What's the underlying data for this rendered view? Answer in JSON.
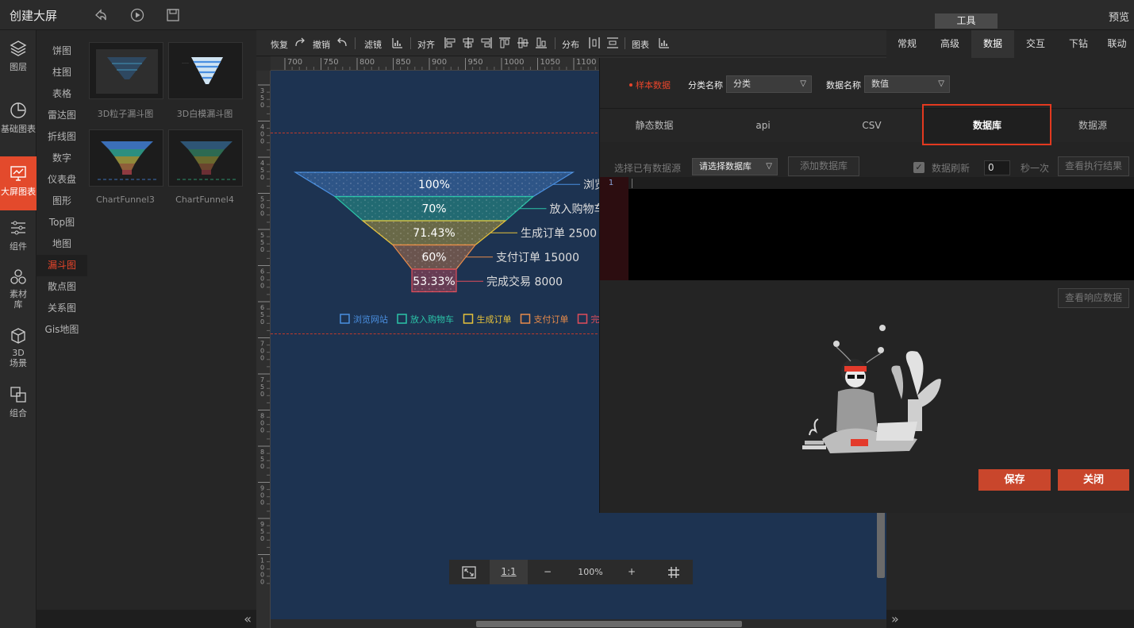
{
  "header": {
    "title": "创建大屏",
    "preview": "预览",
    "tools_tab": "工具"
  },
  "rail": [
    {
      "label": "图层",
      "icon": "layers-icon"
    },
    {
      "label": "基础图表",
      "icon": "pie-chart-icon"
    },
    {
      "label": "大屏图表",
      "icon": "monitor-chart-icon"
    },
    {
      "label": "组件",
      "icon": "sliders-icon"
    },
    {
      "label": "素材库",
      "icon": "materials-icon"
    },
    {
      "label": "3D场景",
      "icon": "cube-icon"
    },
    {
      "label": "组合",
      "icon": "group-icon"
    }
  ],
  "categories": [
    "饼图",
    "柱图",
    "表格",
    "雷达图",
    "折线图",
    "数字",
    "仪表盘",
    "图形",
    "Top图",
    "地图",
    "漏斗图",
    "散点图",
    "关系图",
    "Gis地图"
  ],
  "active_category": "漏斗图",
  "thumbnails": [
    {
      "label": "3D粒子漏斗图"
    },
    {
      "label": "3D白模漏斗图"
    },
    {
      "label": "ChartFunnel3"
    },
    {
      "label": "ChartFunnel4"
    }
  ],
  "toolbar": {
    "redo": "恢复",
    "undo": "撤销",
    "filter": "滤镜",
    "align": "对齐",
    "distribute": "分布",
    "chart": "图表"
  },
  "ruler": {
    "h_ticks": [
      "700",
      "750",
      "800",
      "850",
      "900",
      "950",
      "1000",
      "1050",
      "1100"
    ],
    "v_ticks": [
      "350",
      "400",
      "450",
      "500",
      "550",
      "600",
      "650",
      "700",
      "750",
      "800",
      "850",
      "900",
      "950",
      "1000"
    ]
  },
  "funnel": {
    "stages": [
      {
        "name": "浏览网站",
        "pct": "100%",
        "value": "",
        "color": "#4a8fe0"
      },
      {
        "name": "放入购物车",
        "pct": "70%",
        "value": "",
        "color": "#2bc4a8"
      },
      {
        "name": "生成订单",
        "pct": "71.43%",
        "value": "2500",
        "color": "#e6c23a"
      },
      {
        "name": "支付订单",
        "pct": "60%",
        "value": "15000",
        "color": "#e88b4a"
      },
      {
        "name": "完成交易",
        "pct": "53.33%",
        "value": "8000",
        "color": "#e04d5a"
      }
    ],
    "labels_visible": [
      "浏览",
      "放入购物车",
      "生成订单  2500",
      "支付订单  15000",
      "完成交易  8000"
    ],
    "legend": [
      "浏览网站",
      "放入购物车",
      "生成订单",
      "支付订单",
      "完成"
    ]
  },
  "zoom": {
    "fit_icon": "fit-screen-icon",
    "one_to_one": "1:1",
    "minus": "−",
    "level": "100%",
    "plus": "+",
    "grid_icon": "grid-icon"
  },
  "props_tabs": [
    "常规",
    "高级",
    "数据",
    "交互",
    "下钻",
    "联动"
  ],
  "props_active": "数据",
  "popup": {
    "sample_label": "样本数据",
    "category_label": "分类名称",
    "category_value": "分类",
    "data_label": "数据名称",
    "data_value": "数值",
    "tabs": [
      "静态数据",
      "api",
      "CSV",
      "数据库",
      "数据源"
    ],
    "active_tab": "数据库",
    "choose_source_label": "选择已有数据源",
    "source_select": "请选择数据库",
    "add_db": "添加数据库",
    "refresh_label": "数据刷新",
    "refresh_value": "0",
    "per_seconds": "秒一次",
    "view_exec": "查看执行结果",
    "line_number": "1",
    "view_response": "查看响应数据",
    "save": "保存",
    "close": "关闭"
  }
}
